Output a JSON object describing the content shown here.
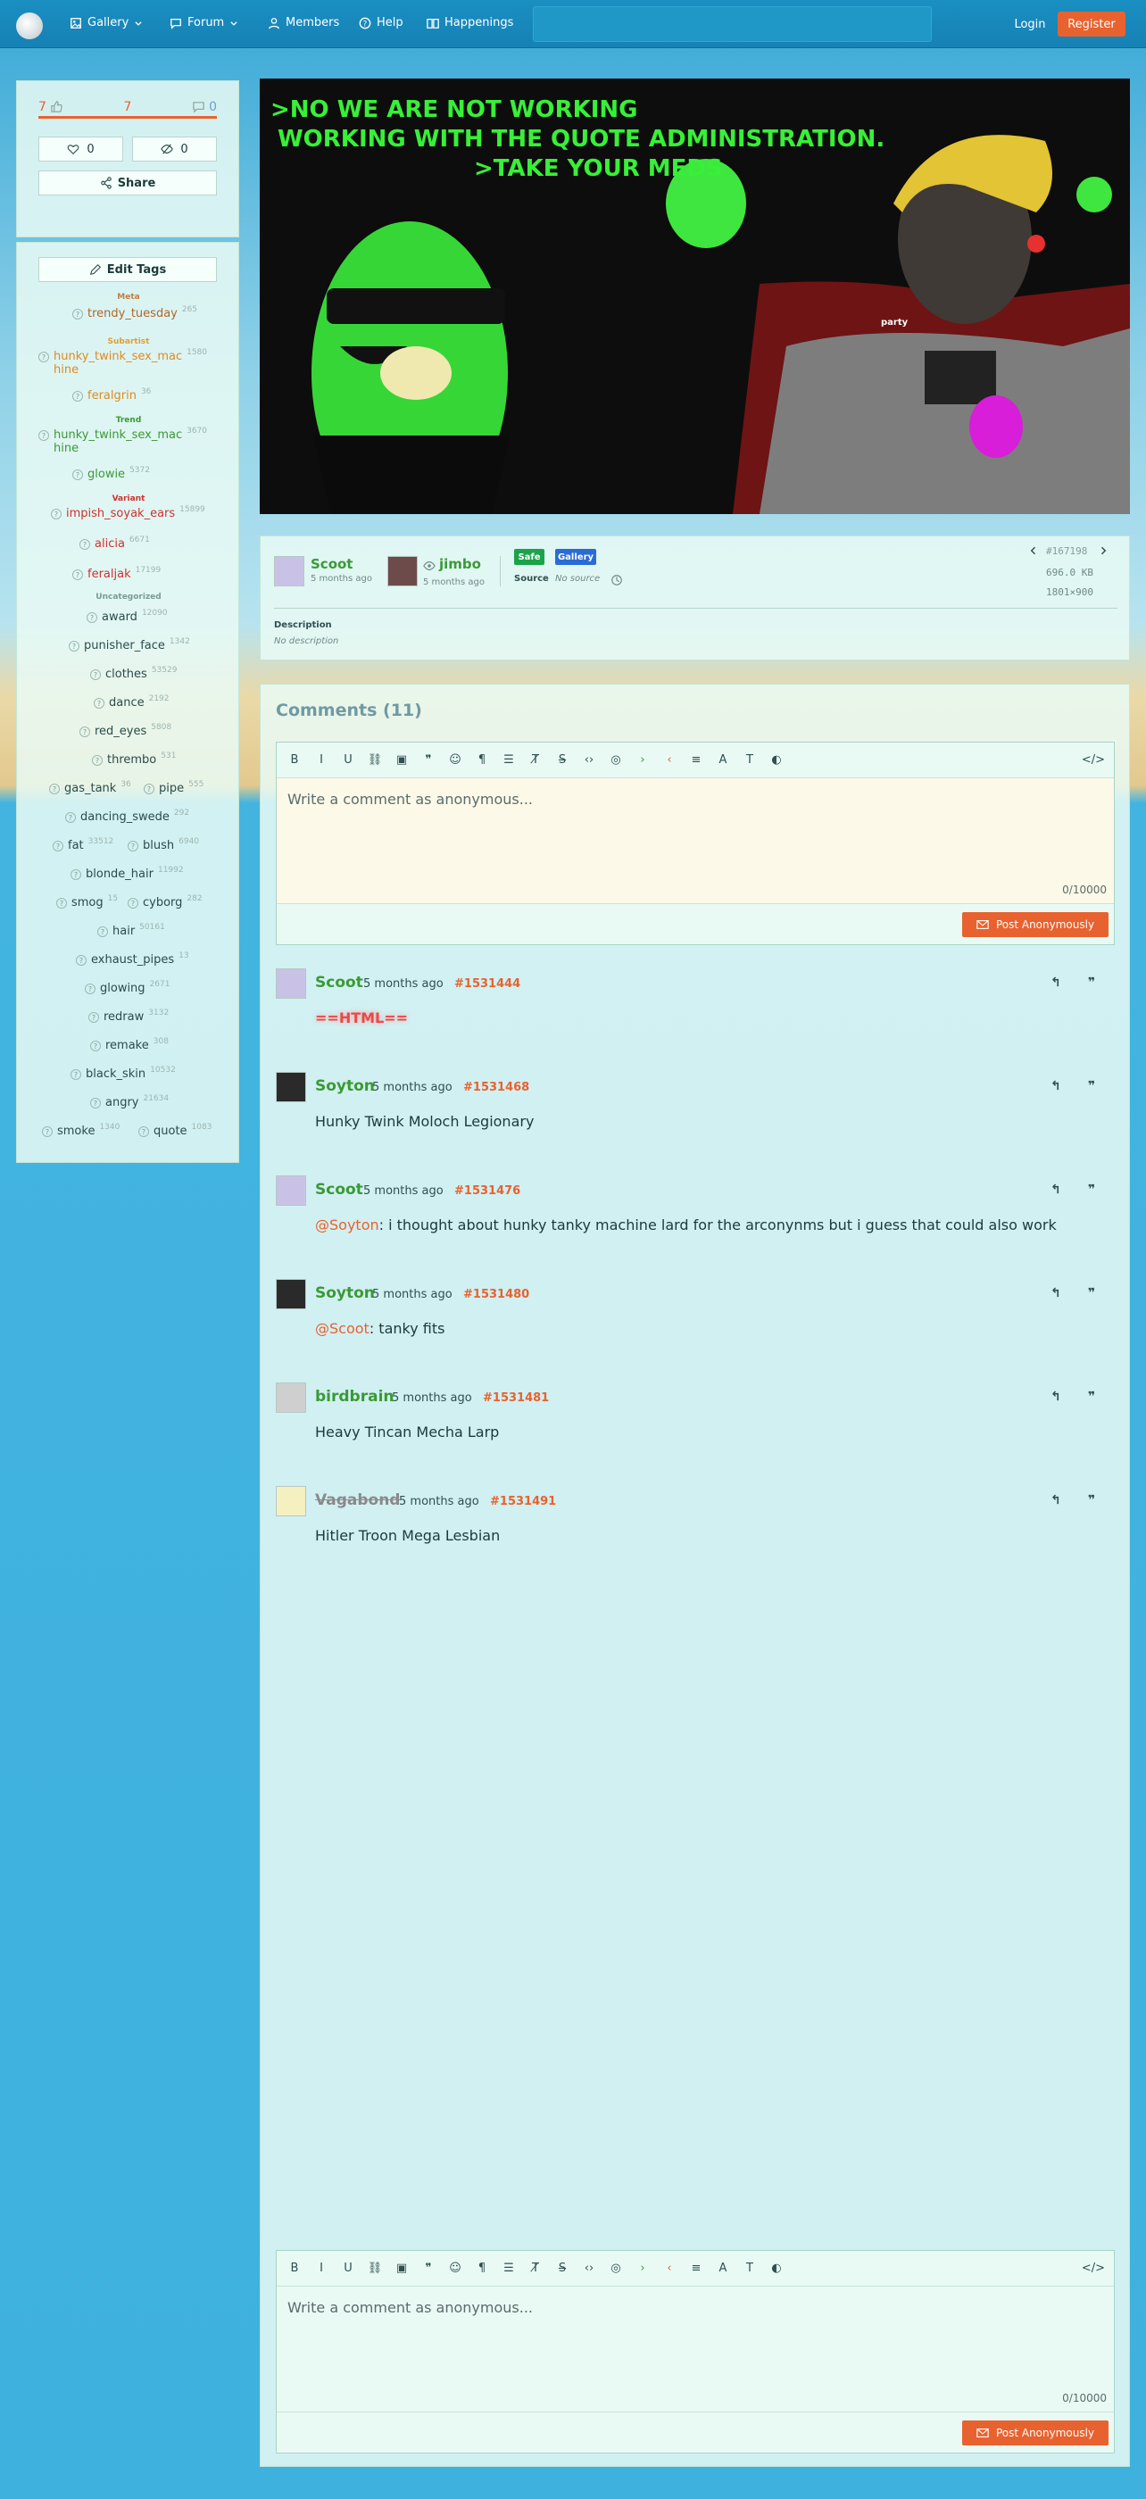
{
  "header": {
    "nav": [
      {
        "label": "Gallery",
        "icon": "image-icon",
        "dropdown": true
      },
      {
        "label": "Forum",
        "icon": "chat-icon",
        "dropdown": true
      },
      {
        "label": "Members",
        "icon": "user-icon",
        "dropdown": false
      },
      {
        "label": "Help",
        "icon": "help-icon",
        "dropdown": false
      },
      {
        "label": "Happenings",
        "icon": "book-icon",
        "dropdown": false
      }
    ],
    "login": "Login",
    "register": "Register"
  },
  "votes": {
    "up": "7",
    "score": "7",
    "comments": "0",
    "favorites": "0",
    "hidden": "0",
    "share": "Share"
  },
  "tags": {
    "edit": "Edit Tags",
    "categories": {
      "meta": "Meta",
      "subartist": "Subartist",
      "trend": "Trend",
      "variant": "Variant",
      "uncategorized": "Uncategorized"
    },
    "meta": [
      {
        "name": "trendy_tuesday",
        "count": "265"
      }
    ],
    "subartist": [
      {
        "name": "hunky_twink_sex_mac\nhine",
        "count": "1580"
      },
      {
        "name": "feralgrin",
        "count": "36"
      }
    ],
    "trend": [
      {
        "name": "hunky_twink_sex_mac\nhine",
        "count": "3670"
      },
      {
        "name": "glowie",
        "count": "5372"
      }
    ],
    "variant": [
      {
        "name": "impish_soyak_ears",
        "count": "15899"
      },
      {
        "name": "alicia",
        "count": "6671"
      },
      {
        "name": "feraljak",
        "count": "17199"
      }
    ],
    "uncategorized": [
      {
        "name": "award",
        "count": "12090"
      },
      {
        "name": "punisher_face",
        "count": "1342"
      },
      {
        "name": "clothes",
        "count": "53529"
      },
      {
        "name": "dance",
        "count": "2192"
      },
      {
        "name": "red_eyes",
        "count": "5808"
      },
      {
        "name": "thrembo",
        "count": "531"
      },
      {
        "name": "gas_tank",
        "count": "36"
      },
      {
        "name": "pipe",
        "count": "555"
      },
      {
        "name": "dancing_swede",
        "count": "292"
      },
      {
        "name": "fat",
        "count": "33512"
      },
      {
        "name": "blush",
        "count": "6940"
      },
      {
        "name": "blonde_hair",
        "count": "11992"
      },
      {
        "name": "smog",
        "count": "15"
      },
      {
        "name": "cyborg",
        "count": "282"
      },
      {
        "name": "hair",
        "count": "50161"
      },
      {
        "name": "exhaust_pipes",
        "count": "13"
      },
      {
        "name": "glowing",
        "count": "2671"
      },
      {
        "name": "redraw",
        "count": "3132"
      },
      {
        "name": "remake",
        "count": "308"
      },
      {
        "name": "black_skin",
        "count": "10532"
      },
      {
        "name": "angry",
        "count": "21634"
      },
      {
        "name": "smoke",
        "count": "1340"
      },
      {
        "name": "quote",
        "count": "1083"
      }
    ]
  },
  "image": {
    "line1": ">NO WE ARE NOT WORKING",
    "line2": "WORKING WITH THE QUOTE ADMINISTRATION.",
    "line3": ">TAKE YOUR MEDS",
    "tag_party": "party"
  },
  "info": {
    "uploader": "Scoot",
    "uploader_date": "5 months ago",
    "editor": "jimbo",
    "editor_date": "5 months ago",
    "badge_rating": "Safe",
    "badge_type": "Gallery",
    "source_label": "Source",
    "source_value": "No source",
    "image_id": "#167198",
    "file_size": "696.0 KB",
    "dimensions": "1801×900",
    "description_label": "Description",
    "description_value": "No description"
  },
  "comments": {
    "title": "Comments",
    "count": "(11)",
    "placeholder": "Write a comment as anonymous...",
    "counter": "0/10000",
    "post": "Post Anonymously",
    "items": [
      {
        "name": "Scoot",
        "date": "5 months ago",
        "id": "#1531444",
        "mention": "",
        "body": "==HTML==",
        "color": "#3a9a34"
      },
      {
        "name": "Soyton",
        "date": "5 months ago",
        "id": "#1531468",
        "mention": "",
        "body": "Hunky Twink Moloch Legionary",
        "color": "#3a9a34"
      },
      {
        "name": "Scoot",
        "date": "5 months ago",
        "id": "#1531476",
        "mention": "@Soyton",
        "body": ": i thought about hunky tanky machine lard for the arconynms but i guess that could also work",
        "color": "#3a9a34"
      },
      {
        "name": "Soyton",
        "date": "5 months ago",
        "id": "#1531480",
        "mention": "@Scoot",
        "body": ": tanky fits",
        "color": "#3a9a34"
      },
      {
        "name": "birdbrain",
        "date": "5 months ago",
        "id": "#1531481",
        "mention": "",
        "body": "Heavy Tincan Mecha Larp",
        "color": "#3a9a34"
      },
      {
        "name": "Vagabond",
        "date": "5 months ago",
        "id": "#1531491",
        "mention": "",
        "body": "Hitler Troon Mega Lesbian",
        "color": "#8a8a8a"
      }
    ]
  },
  "colors": {
    "accent": "#e8622f",
    "green": "#3a9a34",
    "header": "#1681b4",
    "safe": "#1aa34a",
    "gallery": "#2a6bd6"
  }
}
